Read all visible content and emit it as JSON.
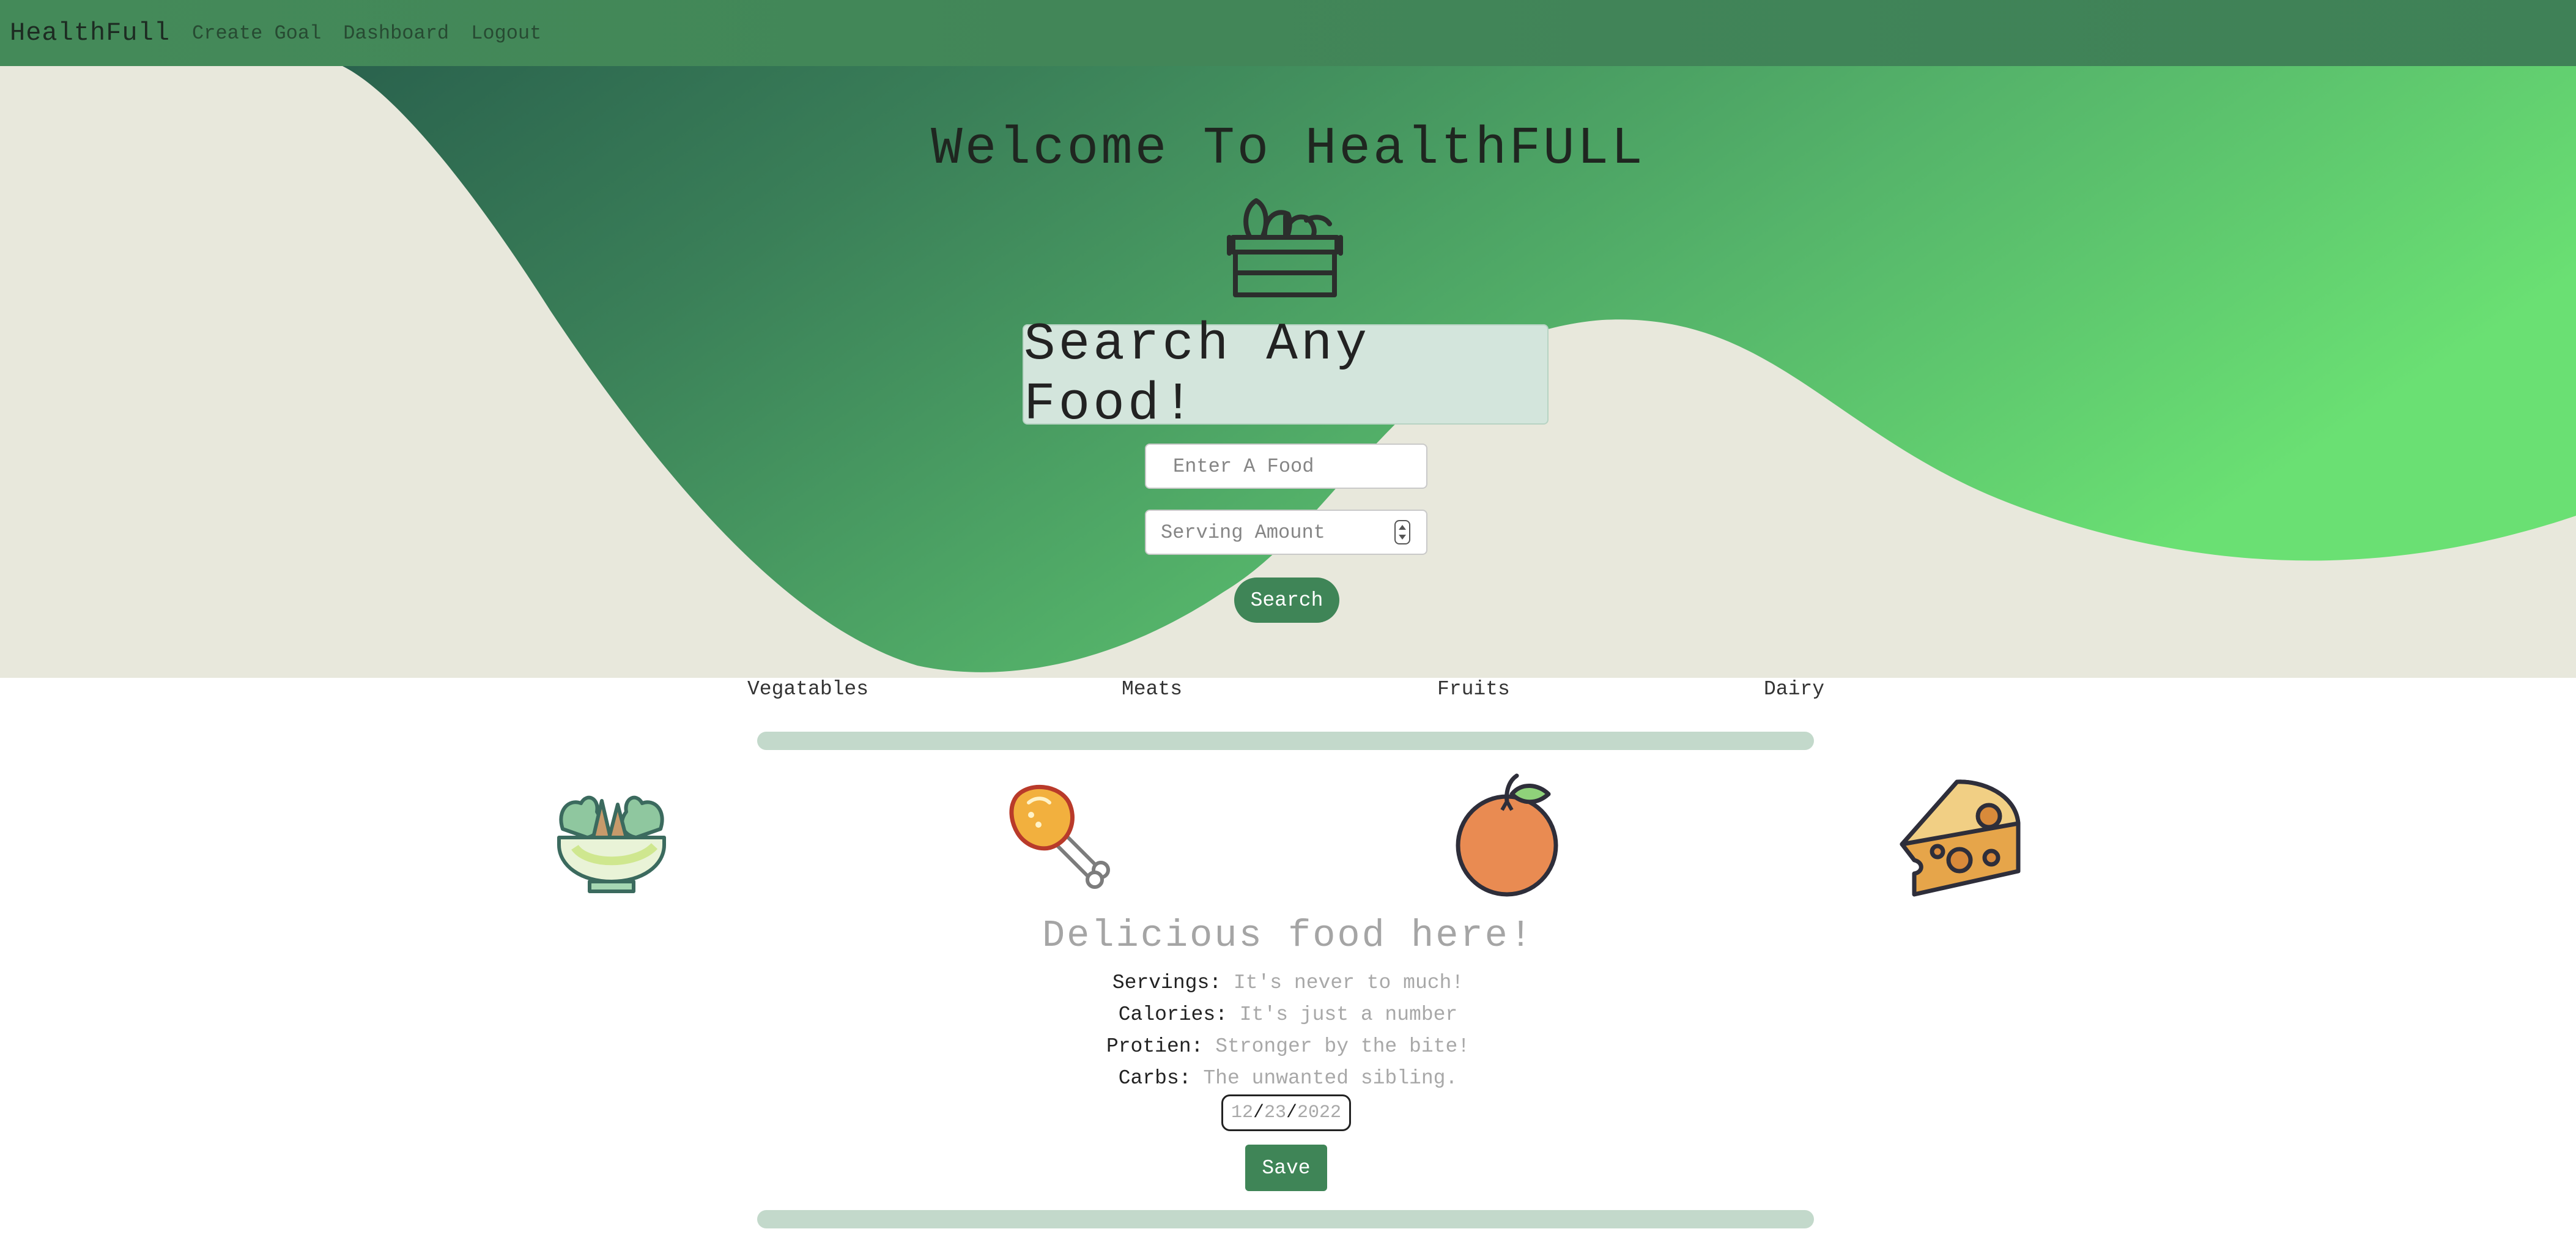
{
  "navbar": {
    "brand": "HealthFull",
    "links": [
      "Create Goal",
      "Dashboard",
      "Logout"
    ]
  },
  "hero": {
    "title": "Welcome To HealthFULL",
    "search_banner": "Search Any Food!",
    "food_placeholder": "Enter A Food",
    "serving_placeholder": "Serving Amount",
    "search_button": "Search"
  },
  "categories": [
    {
      "label": "Vegatables",
      "icon": "salad-bowl-icon"
    },
    {
      "label": "Meats",
      "icon": "drumstick-icon"
    },
    {
      "label": "Fruits",
      "icon": "orange-icon"
    },
    {
      "label": "Dairy",
      "icon": "cheese-icon"
    }
  ],
  "details": {
    "title": "Delicious food here!",
    "rows": [
      {
        "label": "Servings:",
        "value": "It's never to much!"
      },
      {
        "label": "Calories:",
        "value": "It's just a number"
      },
      {
        "label": "Protien:",
        "value": "Stronger by the bite!"
      },
      {
        "label": "Carbs:",
        "value": "The unwanted sibling."
      }
    ],
    "date": {
      "month": "12",
      "day": "23",
      "year": "2022"
    },
    "save_button": "Save"
  },
  "colors": {
    "primary_green": "#3f8557",
    "light_green": "#6ae073",
    "dark_green": "#27594a",
    "hero_bg": "#e8e8dc",
    "bar": "#c3d9cb"
  }
}
